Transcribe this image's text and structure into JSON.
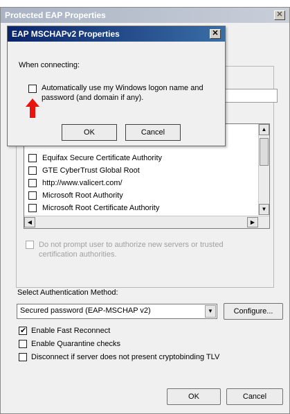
{
  "outer_window": {
    "title": "Protected EAP Properties",
    "close_glyph": "✕"
  },
  "trusted_ca_list": {
    "items": [
      {
        "label": "Equifax Secure Certificate Authority",
        "checked": false
      },
      {
        "label": "GTE CyberTrust Global Root",
        "checked": false
      },
      {
        "label": "http://www.valicert.com/",
        "checked": false
      },
      {
        "label": "Microsoft Root Authority",
        "checked": false
      },
      {
        "label": "Microsoft Root Certificate Authority",
        "checked": false
      }
    ]
  },
  "do_not_prompt": {
    "label_line1": "Do not prompt user to authorize new servers or trusted",
    "label_line2": "certification authorities.",
    "checked": false
  },
  "auth_method": {
    "label": "Select Authentication Method:",
    "selected": "Secured password (EAP-MSCHAP v2)",
    "configure_label": "Configure..."
  },
  "options": [
    {
      "label": "Enable Fast Reconnect",
      "checked": true
    },
    {
      "label": "Enable Quarantine checks",
      "checked": false
    },
    {
      "label": "Disconnect if server does not present cryptobinding TLV",
      "checked": false
    }
  ],
  "outer_buttons": {
    "ok": "OK",
    "cancel": "Cancel"
  },
  "dialog": {
    "title": "EAP MSCHAPv2 Properties",
    "close_glyph": "✕",
    "when_connecting": "When connecting:",
    "auto_logon_line1": "Automatically use my Windows logon name and",
    "auto_logon_line2": "password (and domain if any).",
    "auto_logon_checked": false,
    "ok": "OK",
    "cancel": "Cancel"
  },
  "colors": {
    "annotation_arrow": "#e8130f",
    "dialog_titlebar": "#0a246a"
  }
}
